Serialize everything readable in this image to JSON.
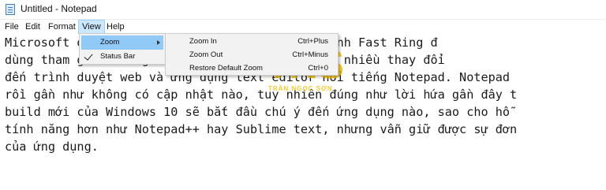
{
  "window": {
    "title": "Untitled - Notepad"
  },
  "menubar": {
    "items": [
      {
        "label": "File"
      },
      {
        "label": "Edit"
      },
      {
        "label": "Format"
      },
      {
        "label": "View"
      },
      {
        "label": "Help"
      }
    ]
  },
  "view_menu": {
    "items": [
      {
        "label": "Zoom",
        "has_submenu": true
      },
      {
        "label": "Status Bar",
        "checked": true
      }
    ]
  },
  "zoom_submenu": {
    "items": [
      {
        "label": "Zoom In",
        "shortcut": "Ctrl+Plus"
      },
      {
        "label": "Zoom Out",
        "shortcut": "Ctrl+Minus"
      },
      {
        "label": "Restore Default Zoom",
        "shortcut": "Ctrl+0"
      }
    ]
  },
  "editor": {
    "lines": [
      "Microsoft đã phát hành bản build 17713 cho nhánh Fast Ring đ",
      "dùng tham gia chương trình. Bản mới này có khá nhiều thay đổi",
      "đến trình duyệt web và ứng dụng text editor nổi tiếng Notepad. Notepad",
      "rồi gần như không có cập nhật nào, tuy nhiên đúng như lời hứa gần đây t",
      "build mới của Windows 10 sẽ bắt đầu chú ý đến ứng dụng nào, sao cho hỗ",
      "tính năng hơn như Notepad++ hay Sublime text, nhưng vẫn giữ được sự đơn",
      "của ứng dụng."
    ]
  },
  "watermark": {
    "logo": "TNS",
    "subtitle": "TRẦN NGỌC SƠN"
  },
  "colors": {
    "menu_active_bg": "#cce8ff",
    "menu_hover_bg": "#91c9f7",
    "watermark": "#f4c20d"
  }
}
